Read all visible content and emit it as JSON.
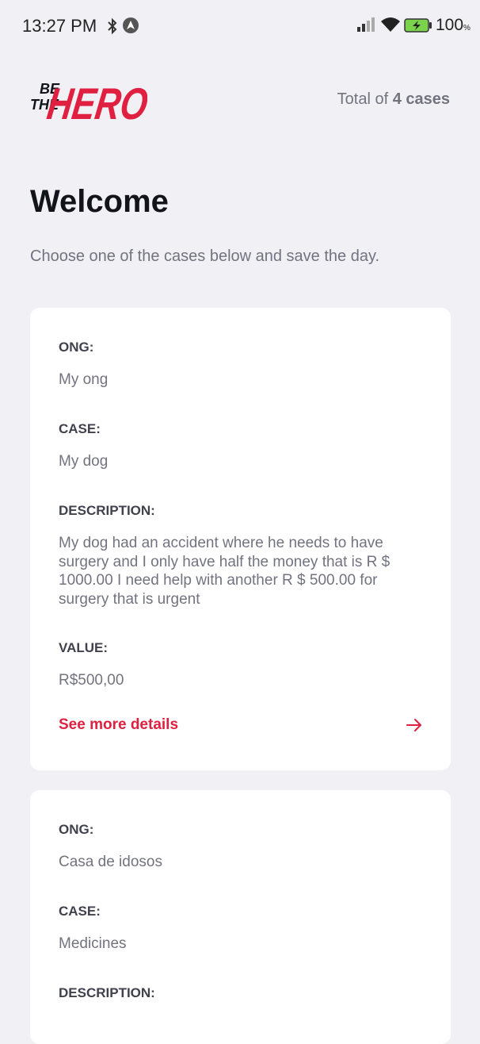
{
  "status_bar": {
    "time": "13:27 PM",
    "battery": "100",
    "battery_unit": "%"
  },
  "header": {
    "logo_text": [
      "BE",
      "THE",
      "HERO"
    ],
    "total_prefix": "Total of",
    "total_count": "4 cases"
  },
  "welcome": {
    "title": "Welcome",
    "subtitle": "Choose one of the cases below and save the day."
  },
  "labels": {
    "ong": "ONG:",
    "case": "CASE:",
    "description": "DESCRIPTION:",
    "value": "VALUE:",
    "details": "See more details"
  },
  "incidents": [
    {
      "ong": "My ong",
      "case": "My dog",
      "description": "My dog had an accident where he needs to have surgery and I only have half the money that is R $ 1000.00 I need help with another R $ 500.00 for surgery that is urgent",
      "value": "R$500,00"
    },
    {
      "ong": "Casa de idosos",
      "case": "Medicines"
    }
  ],
  "colors": {
    "background": "#f0f0f5",
    "accent": "#e02041",
    "card": "#ffffff",
    "text_muted": "#737380",
    "text_label": "#41414d"
  },
  "icons": [
    "bluetooth-icon",
    "navigation-icon",
    "signal-icon",
    "wifi-icon",
    "battery-icon",
    "arrow-right-icon"
  ]
}
